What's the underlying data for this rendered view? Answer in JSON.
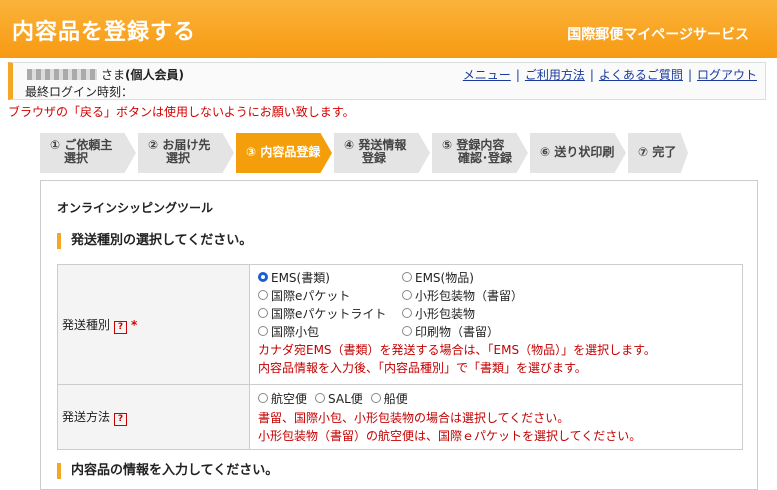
{
  "header": {
    "title": "内容品を登録する",
    "service": "国際郵便マイページサービス"
  },
  "user": {
    "honorific": "さま",
    "member_type": "(個人会員)",
    "last_login_label": "最終ログイン時刻：",
    "links": [
      "メニュー",
      "ご利用方法",
      "よくあるご質問",
      "ログアウト"
    ]
  },
  "warning": "ブラウザの「戻る」ボタンは使用しないようにお願い致します。",
  "steps": [
    {
      "line1": "① ご依頼主",
      "line2": "選択"
    },
    {
      "line1": "② お届け先",
      "line2": "選択"
    },
    {
      "line1": "③ 内容品登録",
      "line2": ""
    },
    {
      "line1": "④ 発送情報",
      "line2": "登録"
    },
    {
      "line1": "⑤ 登録内容",
      "line2": "確認･登録"
    },
    {
      "line1": "⑥ 送り状印刷",
      "line2": ""
    },
    {
      "line1": "⑦ 完了",
      "line2": ""
    }
  ],
  "tool_title": "オンラインシッピングツール",
  "section1_title": "発送種別の選択してください。",
  "section2_title": "内容品の情報を入力してください。",
  "shipping_type": {
    "label": "発送種別",
    "help": "?",
    "required": "*",
    "options": [
      "EMS(書類)",
      "EMS(物品)",
      "国際eパケット",
      "小形包装物（書留）",
      "国際eパケットライト",
      "小形包装物",
      "国際小包",
      "印刷物（書留）"
    ],
    "selected": "EMS(書類)",
    "note1": "カナダ宛EMS（書類）を発送する場合は、「EMS（物品）」を選択します。",
    "note2": "内容品情報を入力後、「内容品種別」で「書類」を選びます。"
  },
  "shipping_method": {
    "label": "発送方法",
    "help": "?",
    "options": [
      "航空便",
      "SAL便",
      "船便"
    ],
    "note1": "書留、国際小包、小形包装物の場合は選択してください。",
    "note2": "小形包装物（書留）の航空便は、国際ｅパケットを選択してください。"
  }
}
